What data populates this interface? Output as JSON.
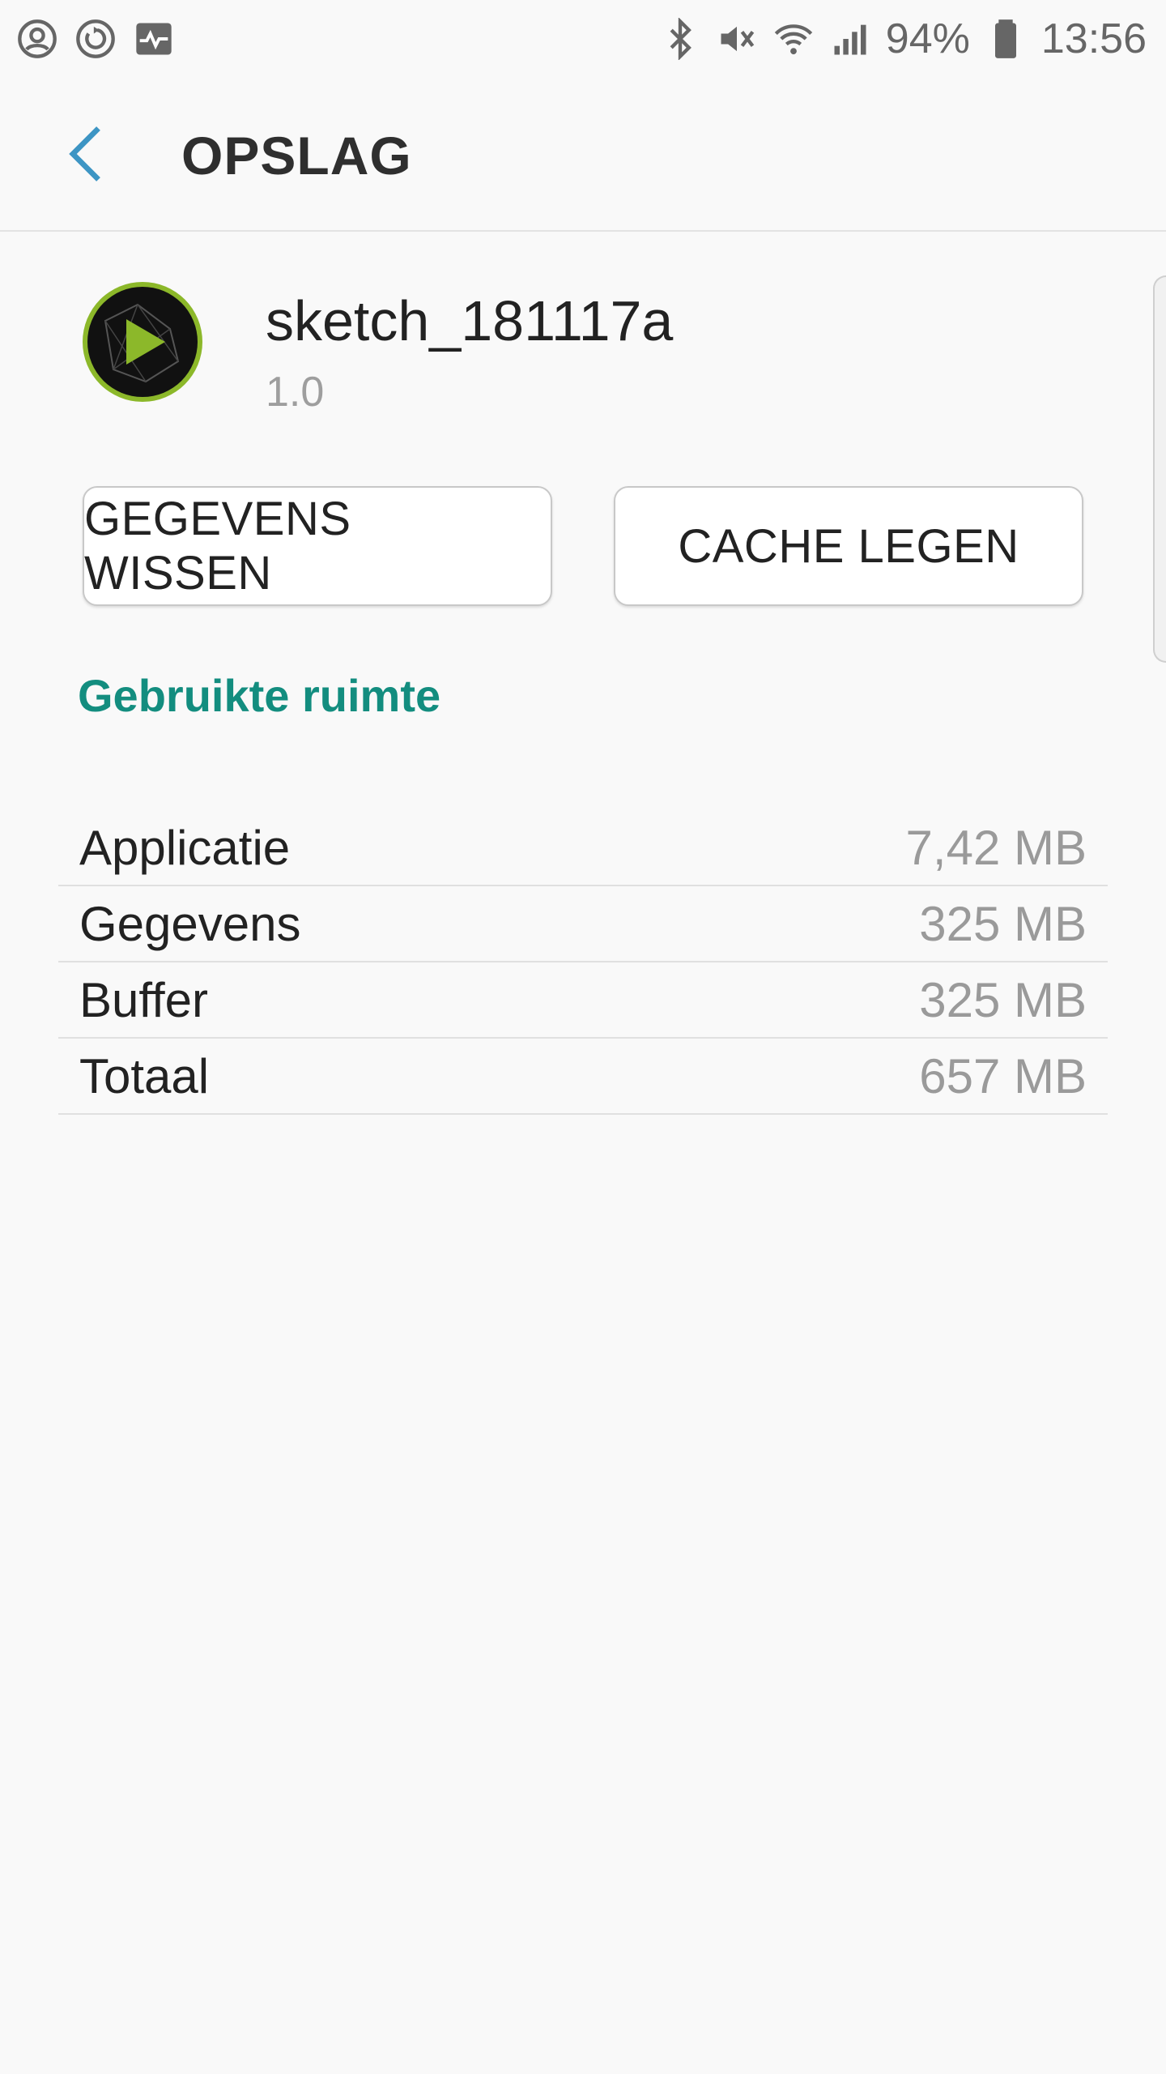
{
  "status_bar": {
    "left_icons": [
      "account-circle-icon",
      "sync-icon",
      "activity-monitor-icon"
    ],
    "right_icons": [
      "bluetooth-icon",
      "vibrate-mute-icon",
      "wifi-icon",
      "signal-icon",
      "battery-icon"
    ],
    "battery_percent": "94%",
    "time": "13:56"
  },
  "app_bar": {
    "title": "OPSLAG",
    "back_icon": "chevron-left-icon"
  },
  "app": {
    "name": "sketch_181117a",
    "version": "1.0",
    "icon": "app-play-icon"
  },
  "buttons": {
    "clear_data": "GEGEVENS WISSEN",
    "clear_cache": "CACHE LEGEN"
  },
  "section": {
    "title": "Gebruikte ruimte"
  },
  "storage": [
    {
      "label": "Applicatie",
      "value": "7,42 MB"
    },
    {
      "label": "Gegevens",
      "value": "325 MB"
    },
    {
      "label": "Buffer",
      "value": "325 MB"
    },
    {
      "label": "Totaal",
      "value": "657 MB"
    }
  ],
  "colors": {
    "accent": "#138d7f",
    "back_arrow": "#3d95c4",
    "background": "#f9f9f9",
    "app_icon_ring": "#8cb82a"
  }
}
